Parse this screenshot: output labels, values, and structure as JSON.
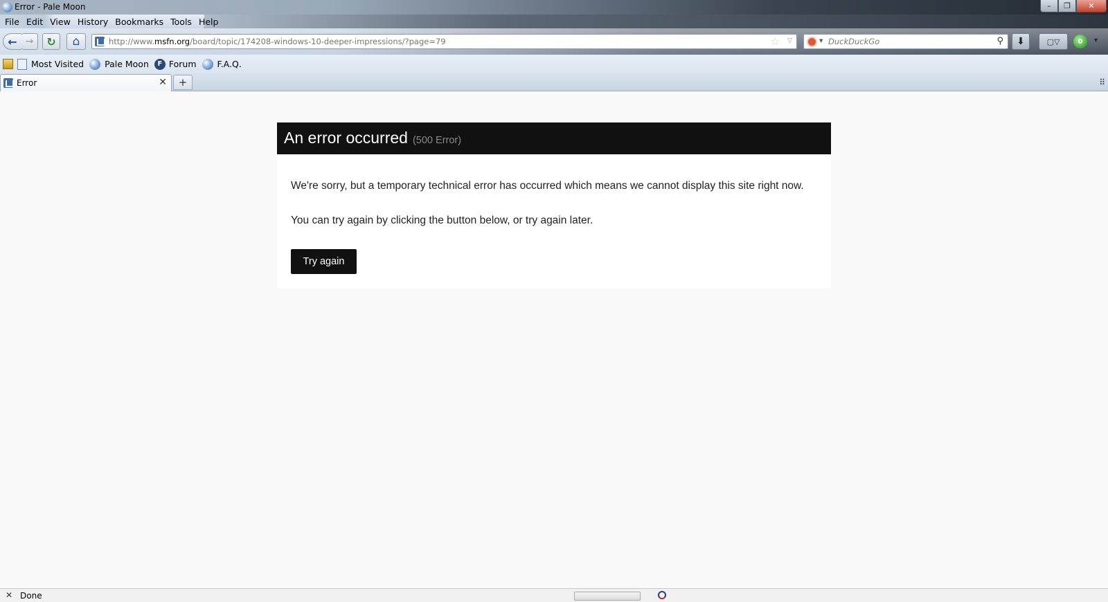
{
  "window": {
    "title": "Error - Pale Moon",
    "controls": {
      "minimize": "–",
      "maximize": "❐",
      "close": "✕"
    }
  },
  "menu": {
    "items": [
      {
        "label": "File"
      },
      {
        "label": "Edit"
      },
      {
        "label": "View"
      },
      {
        "label": "History"
      },
      {
        "label": "Bookmarks"
      },
      {
        "label": "Tools"
      },
      {
        "label": "Help"
      }
    ]
  },
  "nav": {
    "back": "←",
    "forward": "→",
    "reload": "↻",
    "home": "⌂",
    "url_prefix": "http://www.",
    "url_domain": "msfn.org",
    "url_path": "/board/topic/174208-windows-10-deeper-impressions/?page=79",
    "star": "☆",
    "url_dropdown": "▽",
    "search_placeholder": "DuckDuckGo",
    "search_glass": "⚲",
    "search_dropdown": "▼",
    "download": "⬇",
    "ext_label": "▢▽",
    "green_badge": "0",
    "overflow": "▾"
  },
  "bookmarks": [
    {
      "label": "Most Visited",
      "icon": "document-icon"
    },
    {
      "label": "Pale Moon",
      "icon": "globe-icon"
    },
    {
      "label": "Forum",
      "icon": "forum-icon"
    },
    {
      "label": "F.A.Q.",
      "icon": "globe-icon"
    }
  ],
  "tabs": [
    {
      "label": "Error",
      "close": "✕"
    }
  ],
  "tabstrip": {
    "new_tab": "+",
    "list": "⠿"
  },
  "error": {
    "title": "An error occurred",
    "code": "(500 Error)",
    "message1": "We're sorry, but a temporary technical error has occurred which means we cannot display this site right now.",
    "message2": "You can try again by clicking the button below, or try again later.",
    "button": "Try again"
  },
  "status": {
    "close": "✕",
    "text": "Done"
  }
}
